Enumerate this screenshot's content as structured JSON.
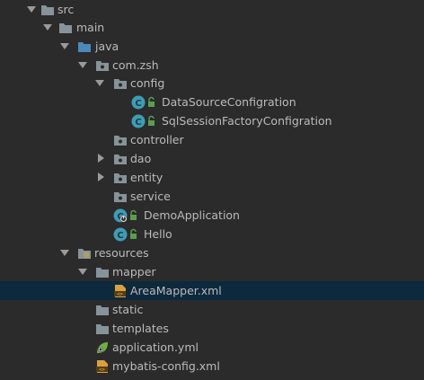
{
  "tree": {
    "items": [
      {
        "label": "src",
        "icon": "folder-icon",
        "arrow": "down"
      },
      {
        "label": "main",
        "icon": "folder-icon",
        "arrow": "down"
      },
      {
        "label": "java",
        "icon": "source-folder-icon",
        "arrow": "down"
      },
      {
        "label": "com.zsh",
        "icon": "package-icon",
        "arrow": "down"
      },
      {
        "label": "config",
        "icon": "package-icon",
        "arrow": "down"
      },
      {
        "label": "DataSourceConfigration",
        "icon": "class-icon",
        "lock": true
      },
      {
        "label": "SqlSessionFactoryConfigration",
        "icon": "class-icon",
        "lock": true
      },
      {
        "label": "controller",
        "icon": "package-icon"
      },
      {
        "label": "dao",
        "icon": "package-icon",
        "arrow": "right"
      },
      {
        "label": "entity",
        "icon": "package-icon",
        "arrow": "right"
      },
      {
        "label": "service",
        "icon": "package-icon"
      },
      {
        "label": "DemoApplication",
        "icon": "spring-boot-class-icon",
        "lock": true
      },
      {
        "label": "Hello",
        "icon": "class-icon",
        "lock": true
      },
      {
        "label": "resources",
        "icon": "resources-folder-icon",
        "arrow": "down"
      },
      {
        "label": "mapper",
        "icon": "folder-icon",
        "arrow": "down"
      },
      {
        "label": "AreaMapper.xml",
        "icon": "xml-file-icon",
        "selected": true
      },
      {
        "label": "static",
        "icon": "folder-icon"
      },
      {
        "label": "templates",
        "icon": "folder-icon"
      },
      {
        "label": "application.yml",
        "icon": "spring-yml-icon"
      },
      {
        "label": "mybatis-config.xml",
        "icon": "xml-file-icon"
      }
    ]
  },
  "colors": {
    "background": "#2b2b2b",
    "selection": "#0d293e",
    "text": "#bbbbbb",
    "folder": "#87939a",
    "source_folder": "#4a8ab8",
    "class": "#3d9db5",
    "lock": "#5b9e4d",
    "xml": "#d9a13d",
    "spring": "#6db33f"
  }
}
